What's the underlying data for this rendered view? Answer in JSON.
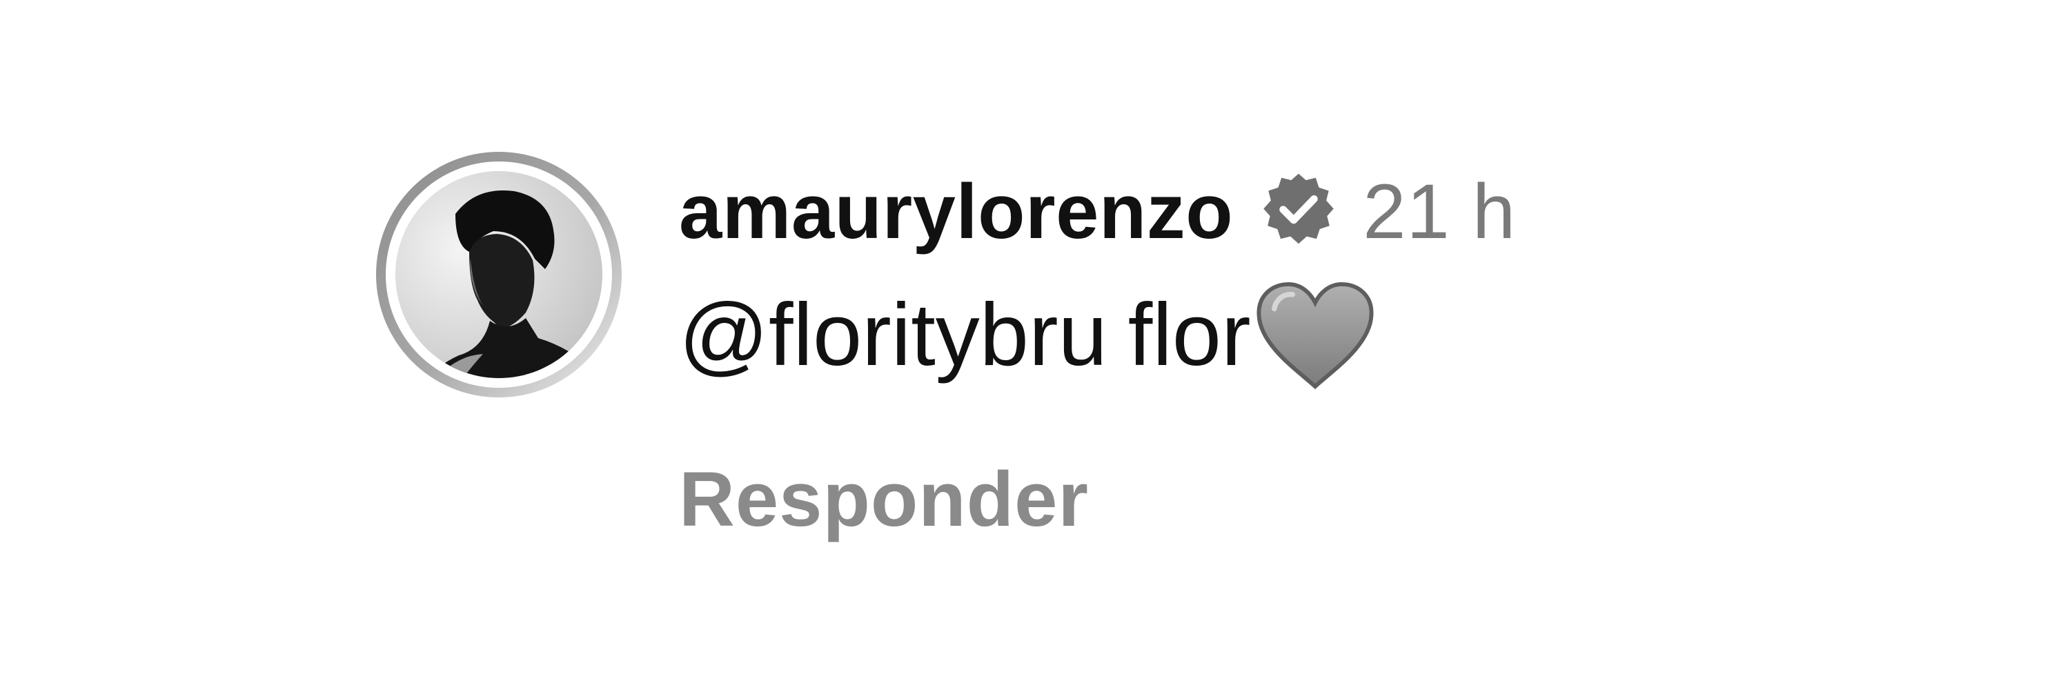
{
  "comment": {
    "avatar": {
      "icon": "profile-photo",
      "ring_colors": [
        "#9a9a9a",
        "#e2e2e2"
      ]
    },
    "username": "amaurylorenzo",
    "verified_icon": "verified-badge-icon",
    "timestamp": "21 h",
    "mention": "@floritybru",
    "text": "flor",
    "emoji_icon": "grey-heart-icon",
    "reply_label": "Responder"
  },
  "colors": {
    "text": "#111111",
    "muted": "#7a7a7a",
    "reply": "#8a8a8a",
    "background": "#ffffff"
  }
}
